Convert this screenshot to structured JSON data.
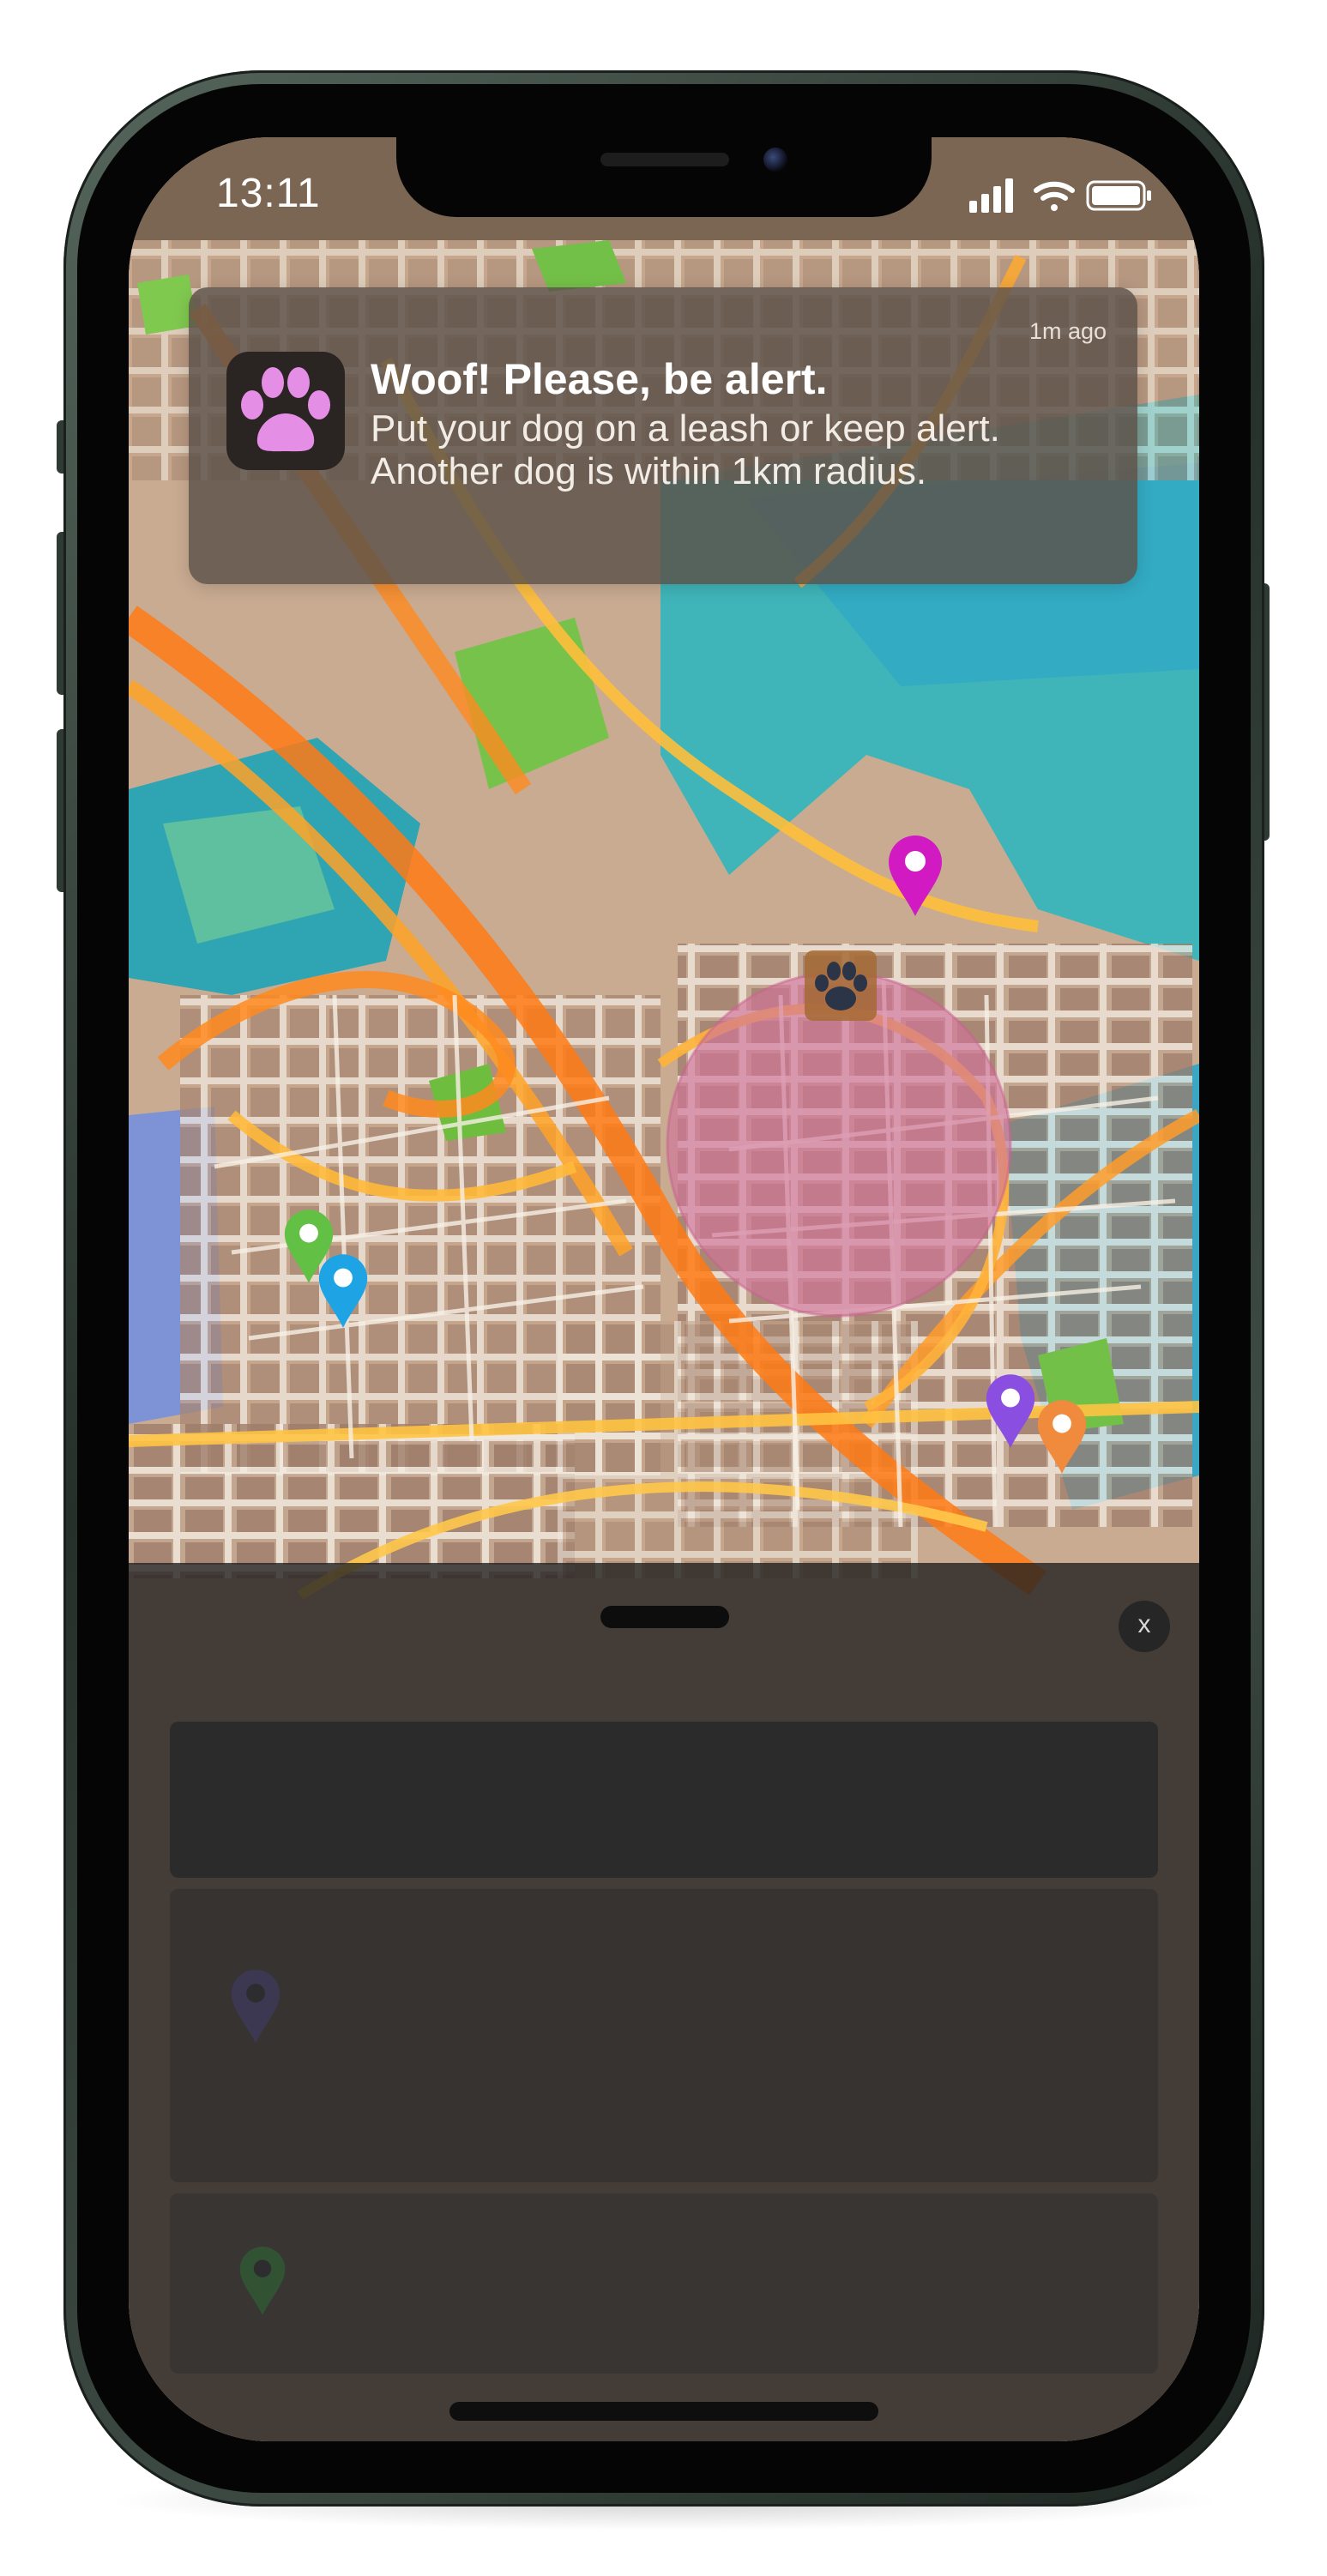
{
  "status_bar": {
    "time": "13:11",
    "icons": [
      "signal-icon",
      "wifi-icon",
      "battery-icon"
    ]
  },
  "notification": {
    "app_icon": "paw-icon",
    "app_icon_color": "#e58ee6",
    "time": "1m ago",
    "title": "Woof! Please, be alert.",
    "body": "Put your dog on a leash or keep alert. Another dog is within 1km radius."
  },
  "map": {
    "user_marker": "paw-marker-icon",
    "radius_color": "#d0739a",
    "pins": [
      {
        "name": "map-pin-magenta",
        "color": "#d21ac3"
      },
      {
        "name": "map-pin-green",
        "color": "#62c045"
      },
      {
        "name": "map-pin-blue",
        "color": "#1ea4e4"
      },
      {
        "name": "map-pin-purple",
        "color": "#8a4fe0"
      },
      {
        "name": "map-pin-orange",
        "color": "#f08a3c"
      }
    ]
  },
  "bottom_sheet": {
    "close_label": "x"
  }
}
